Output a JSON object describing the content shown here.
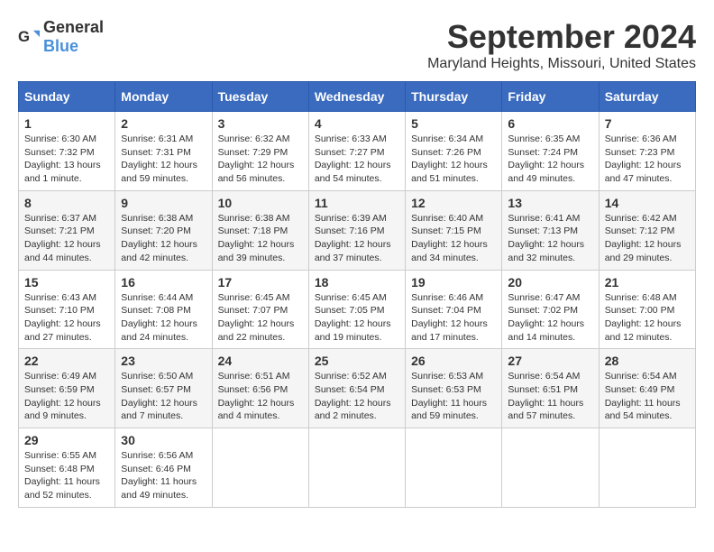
{
  "header": {
    "logo_general": "General",
    "logo_blue": "Blue",
    "month_title": "September 2024",
    "location": "Maryland Heights, Missouri, United States"
  },
  "calendar": {
    "days_of_week": [
      "Sunday",
      "Monday",
      "Tuesday",
      "Wednesday",
      "Thursday",
      "Friday",
      "Saturday"
    ],
    "weeks": [
      [
        {
          "day": "1",
          "sunrise": "6:30 AM",
          "sunset": "7:32 PM",
          "daylight": "13 hours and 1 minute."
        },
        {
          "day": "2",
          "sunrise": "6:31 AM",
          "sunset": "7:31 PM",
          "daylight": "12 hours and 59 minutes."
        },
        {
          "day": "3",
          "sunrise": "6:32 AM",
          "sunset": "7:29 PM",
          "daylight": "12 hours and 56 minutes."
        },
        {
          "day": "4",
          "sunrise": "6:33 AM",
          "sunset": "7:27 PM",
          "daylight": "12 hours and 54 minutes."
        },
        {
          "day": "5",
          "sunrise": "6:34 AM",
          "sunset": "7:26 PM",
          "daylight": "12 hours and 51 minutes."
        },
        {
          "day": "6",
          "sunrise": "6:35 AM",
          "sunset": "7:24 PM",
          "daylight": "12 hours and 49 minutes."
        },
        {
          "day": "7",
          "sunrise": "6:36 AM",
          "sunset": "7:23 PM",
          "daylight": "12 hours and 47 minutes."
        }
      ],
      [
        {
          "day": "8",
          "sunrise": "6:37 AM",
          "sunset": "7:21 PM",
          "daylight": "12 hours and 44 minutes."
        },
        {
          "day": "9",
          "sunrise": "6:38 AM",
          "sunset": "7:20 PM",
          "daylight": "12 hours and 42 minutes."
        },
        {
          "day": "10",
          "sunrise": "6:38 AM",
          "sunset": "7:18 PM",
          "daylight": "12 hours and 39 minutes."
        },
        {
          "day": "11",
          "sunrise": "6:39 AM",
          "sunset": "7:16 PM",
          "daylight": "12 hours and 37 minutes."
        },
        {
          "day": "12",
          "sunrise": "6:40 AM",
          "sunset": "7:15 PM",
          "daylight": "12 hours and 34 minutes."
        },
        {
          "day": "13",
          "sunrise": "6:41 AM",
          "sunset": "7:13 PM",
          "daylight": "12 hours and 32 minutes."
        },
        {
          "day": "14",
          "sunrise": "6:42 AM",
          "sunset": "7:12 PM",
          "daylight": "12 hours and 29 minutes."
        }
      ],
      [
        {
          "day": "15",
          "sunrise": "6:43 AM",
          "sunset": "7:10 PM",
          "daylight": "12 hours and 27 minutes."
        },
        {
          "day": "16",
          "sunrise": "6:44 AM",
          "sunset": "7:08 PM",
          "daylight": "12 hours and 24 minutes."
        },
        {
          "day": "17",
          "sunrise": "6:45 AM",
          "sunset": "7:07 PM",
          "daylight": "12 hours and 22 minutes."
        },
        {
          "day": "18",
          "sunrise": "6:45 AM",
          "sunset": "7:05 PM",
          "daylight": "12 hours and 19 minutes."
        },
        {
          "day": "19",
          "sunrise": "6:46 AM",
          "sunset": "7:04 PM",
          "daylight": "12 hours and 17 minutes."
        },
        {
          "day": "20",
          "sunrise": "6:47 AM",
          "sunset": "7:02 PM",
          "daylight": "12 hours and 14 minutes."
        },
        {
          "day": "21",
          "sunrise": "6:48 AM",
          "sunset": "7:00 PM",
          "daylight": "12 hours and 12 minutes."
        }
      ],
      [
        {
          "day": "22",
          "sunrise": "6:49 AM",
          "sunset": "6:59 PM",
          "daylight": "12 hours and 9 minutes."
        },
        {
          "day": "23",
          "sunrise": "6:50 AM",
          "sunset": "6:57 PM",
          "daylight": "12 hours and 7 minutes."
        },
        {
          "day": "24",
          "sunrise": "6:51 AM",
          "sunset": "6:56 PM",
          "daylight": "12 hours and 4 minutes."
        },
        {
          "day": "25",
          "sunrise": "6:52 AM",
          "sunset": "6:54 PM",
          "daylight": "12 hours and 2 minutes."
        },
        {
          "day": "26",
          "sunrise": "6:53 AM",
          "sunset": "6:53 PM",
          "daylight": "11 hours and 59 minutes."
        },
        {
          "day": "27",
          "sunrise": "6:54 AM",
          "sunset": "6:51 PM",
          "daylight": "11 hours and 57 minutes."
        },
        {
          "day": "28",
          "sunrise": "6:54 AM",
          "sunset": "6:49 PM",
          "daylight": "11 hours and 54 minutes."
        }
      ],
      [
        {
          "day": "29",
          "sunrise": "6:55 AM",
          "sunset": "6:48 PM",
          "daylight": "11 hours and 52 minutes."
        },
        {
          "day": "30",
          "sunrise": "6:56 AM",
          "sunset": "6:46 PM",
          "daylight": "11 hours and 49 minutes."
        },
        null,
        null,
        null,
        null,
        null
      ]
    ]
  }
}
